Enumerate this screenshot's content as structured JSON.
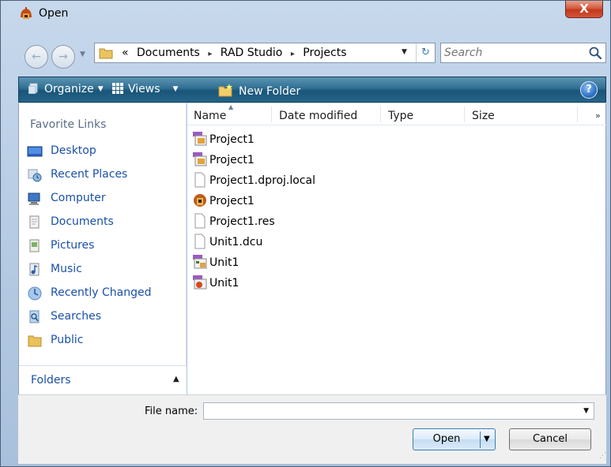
{
  "window": {
    "title": "Open",
    "close_glyph": "X"
  },
  "address_bar": {
    "back_glyph": "←",
    "forward_glyph": "→",
    "overflow": "«",
    "crumbs": [
      "Documents",
      "RAD Studio",
      "Projects"
    ],
    "crumb_separator": "▸",
    "search_placeholder": "Search"
  },
  "toolbar": {
    "organize_label": "Organize",
    "views_label": "Views",
    "new_folder_label": "New Folder",
    "help_glyph": "?"
  },
  "sidebar": {
    "favorite_links_title": "Favorite Links",
    "links": [
      {
        "label": "Desktop",
        "icon": "desktop-icon"
      },
      {
        "label": "Recent Places",
        "icon": "recent-places-icon"
      },
      {
        "label": "Computer",
        "icon": "computer-icon"
      },
      {
        "label": "Documents",
        "icon": "documents-icon"
      },
      {
        "label": "Pictures",
        "icon": "pictures-icon"
      },
      {
        "label": "Music",
        "icon": "music-icon"
      },
      {
        "label": "Recently Changed",
        "icon": "recently-changed-icon"
      },
      {
        "label": "Searches",
        "icon": "searches-icon"
      },
      {
        "label": "Public",
        "icon": "public-folder-icon"
      }
    ],
    "folders_label": "Folders"
  },
  "file_list": {
    "columns": [
      "Name",
      "Date modified",
      "Type",
      "Size"
    ],
    "more_glyph": "»",
    "files": [
      {
        "name": "Project1",
        "icon": "delphi-project-icon"
      },
      {
        "name": "Project1",
        "icon": "delphi-project-icon"
      },
      {
        "name": "Project1.dproj.local",
        "icon": "blank-file-icon"
      },
      {
        "name": "Project1",
        "icon": "application-icon"
      },
      {
        "name": "Project1.res",
        "icon": "blank-file-icon"
      },
      {
        "name": "Unit1.dcu",
        "icon": "blank-file-icon"
      },
      {
        "name": "Unit1",
        "icon": "delphi-form-icon"
      },
      {
        "name": "Unit1",
        "icon": "delphi-unit-icon"
      }
    ]
  },
  "footer": {
    "file_name_label": "File name:",
    "file_name_value": "",
    "open_label": "Open",
    "cancel_label": "Cancel"
  },
  "colors": {
    "toolbar": "#246488",
    "link": "#1a50a8",
    "close": "#c2381b"
  }
}
